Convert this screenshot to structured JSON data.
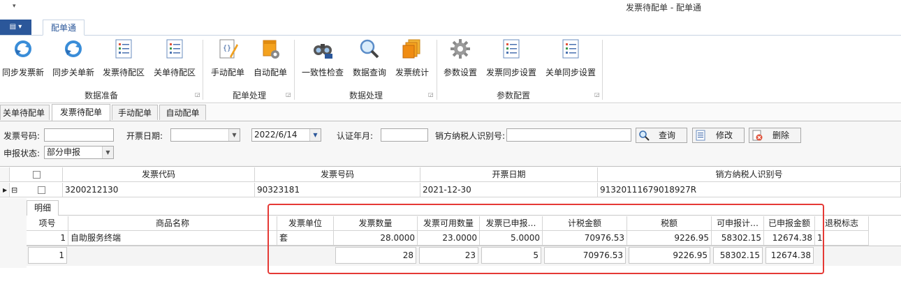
{
  "window": {
    "title": "发票待配单 - 配单通",
    "qat_glyph": "▾"
  },
  "ribbon_tab": "配单通",
  "file_glyph": "▤ ▾",
  "ribbon": {
    "buttons": [
      {
        "label": "同步发票新",
        "icon": "sync-icon"
      },
      {
        "label": "同步关单新",
        "icon": "sync-icon"
      },
      {
        "label": "发票待配区",
        "icon": "list-icon"
      },
      {
        "label": "关单待配区",
        "icon": "list-icon"
      },
      {
        "label": "手动配单",
        "icon": "edit-code-icon"
      },
      {
        "label": "自动配单",
        "icon": "auto-icon"
      },
      {
        "label": "一致性检查",
        "icon": "binoculars-icon"
      },
      {
        "label": "数据查询",
        "icon": "magnifier-icon"
      },
      {
        "label": "发票统计",
        "icon": "stack-icon"
      },
      {
        "label": "参数设置",
        "icon": "gear-icon"
      },
      {
        "label": "发票同步设置",
        "icon": "list-icon"
      },
      {
        "label": "关单同步设置",
        "icon": "list-icon"
      }
    ],
    "groups": [
      "数据准备",
      "配单处理",
      "数据处理",
      "参数配置"
    ]
  },
  "page_tabs": [
    "关单待配单",
    "发票待配单",
    "手动配单",
    "自动配单"
  ],
  "filters": {
    "invoice_no_label": "发票号码:",
    "invoice_no_value": "",
    "date_label": "开票日期:",
    "date_from": "",
    "date_to": "2022/6/14",
    "cert_label": "认证年月:",
    "cert_value": "",
    "seller_label": "销方纳税人识别号:",
    "seller_value": "",
    "status_label": "申报状态:",
    "status_value": "部分申报",
    "query_label": "查询",
    "edit_label": "修改",
    "delete_label": "删除"
  },
  "master": {
    "headers": [
      "发票代码",
      "发票号码",
      "开票日期",
      "销方纳税人识别号"
    ],
    "row": {
      "code": "3200212130",
      "number": "90323181",
      "date": "2021-12-30",
      "seller_id": "91320111679018927R"
    }
  },
  "detail": {
    "tab": "明细",
    "headers": [
      "项号",
      "商品名称",
      "发票单位",
      "发票数量",
      "发票可用数量",
      "发票已申报…",
      "计税金额",
      "税额",
      "可申报计…",
      "已申报金额",
      "退税标志"
    ],
    "row": {
      "no": "1",
      "name": "自助服务终端",
      "unit": "套",
      "qty": "28.0000",
      "avail": "23.0000",
      "declared": "5.0000",
      "amount": "70976.53",
      "tax": "9226.95",
      "declarable": "58302.15",
      "declared_amt": "12674.38",
      "flag": "1"
    },
    "summary": {
      "count": "1",
      "qty": "28",
      "avail": "23",
      "declared": "5",
      "amount": "70976.53",
      "tax": "9226.95",
      "declarable": "58302.15",
      "declared_amt": "12674.38"
    }
  },
  "colors": {
    "accent": "#2b579a",
    "highlight": "#e53935"
  }
}
